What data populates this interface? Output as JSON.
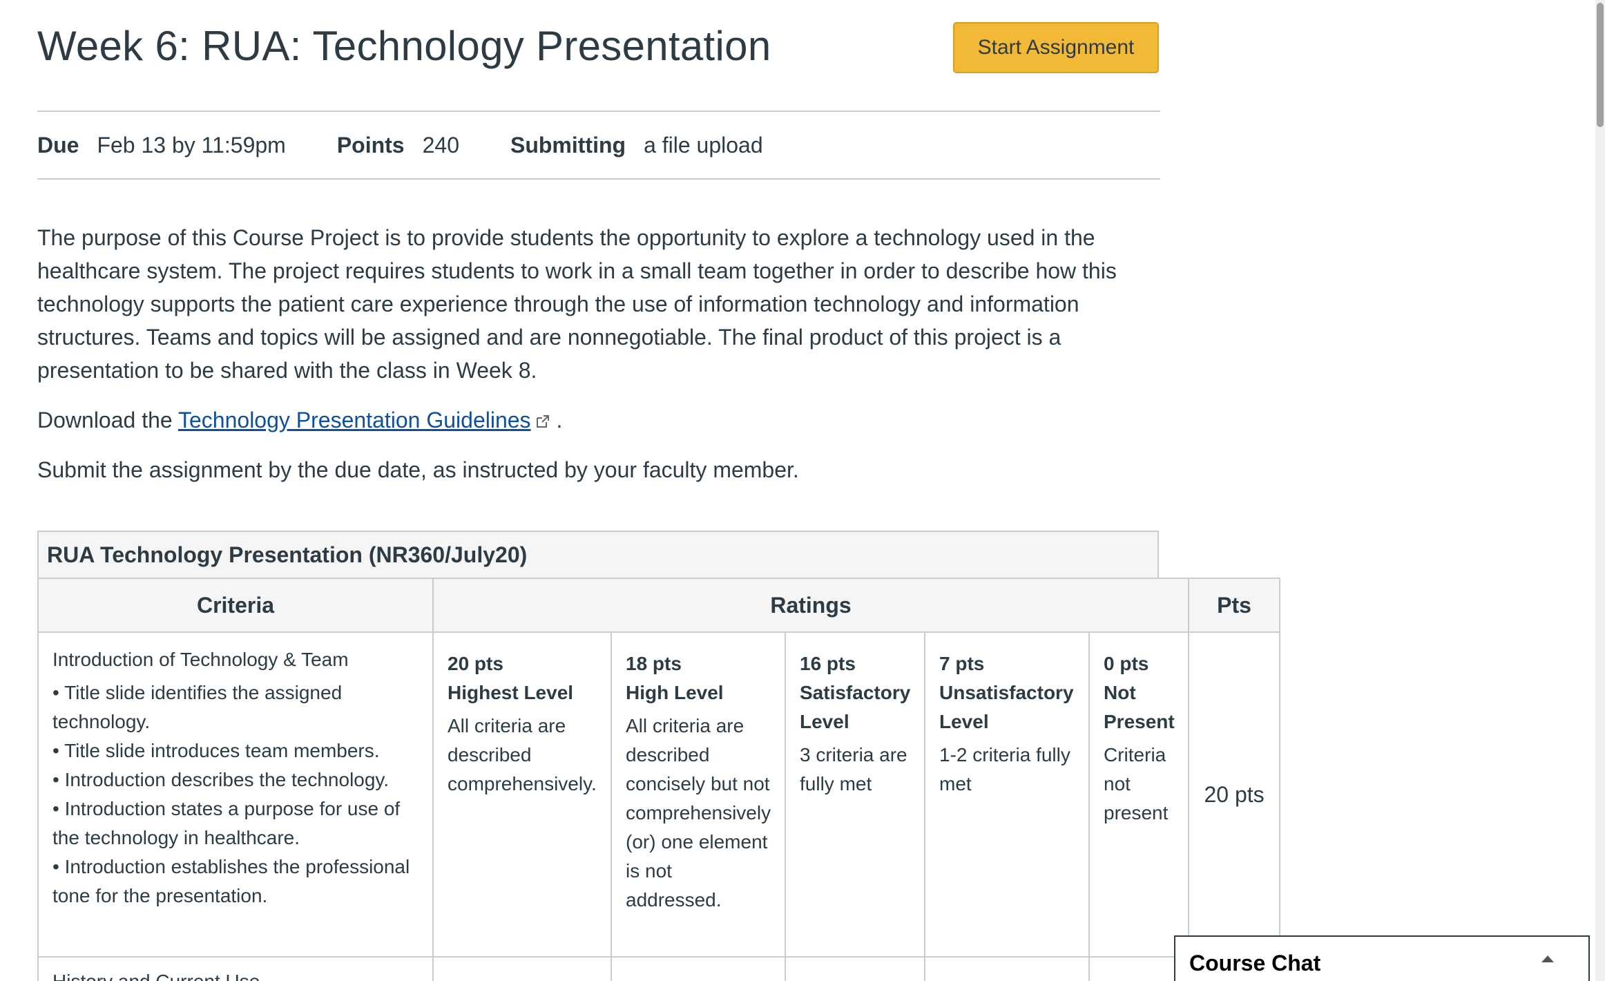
{
  "assignment": {
    "title": "Week 6: RUA: Technology Presentation",
    "start_button_label": "Start Assignment"
  },
  "meta": {
    "due_label": "Due",
    "due_value": "Feb 13 by 11:59pm",
    "points_label": "Points",
    "points_value": "240",
    "submitting_label": "Submitting",
    "submitting_value": "a file upload"
  },
  "description": {
    "paragraph": "The purpose of this Course Project is to provide students the opportunity to explore a technology used in the healthcare system. The project requires students to work in a small team together in order to describe how this technology supports the patient care experience through the use of information technology and information structures. Teams and topics will be assigned and are nonnegotiable. The final product of this project is a presentation to be shared with the class in Week 8.",
    "download_prefix": "Download the ",
    "download_link": "Technology Presentation Guidelines",
    "download_suffix": " .",
    "submit_text": "Submit the assignment by the due date, as instructed by your faculty member."
  },
  "rubric": {
    "title": "RUA Technology Presentation (NR360/July20)",
    "headers": {
      "criteria": "Criteria",
      "ratings": "Ratings",
      "pts": "Pts"
    },
    "rows": [
      {
        "criteria_title": "Introduction of Technology & Team",
        "bullets": [
          "• Title slide identifies the assigned technology.",
          "• Title slide introduces team members.",
          "• Introduction describes the technology.",
          "• Introduction states a purpose for use of the technology in healthcare.",
          "• Introduction establishes the professional tone for the presentation."
        ],
        "ratings": [
          {
            "pts": "20 pts",
            "level": "Highest Level",
            "desc": "All criteria are described comprehensively."
          },
          {
            "pts": "18 pts",
            "level": "High Level",
            "desc": "All criteria are described concisely but not comprehensively (or) one element is not addressed."
          },
          {
            "pts": "16 pts",
            "level": "Satisfactory Level",
            "desc": "3 criteria are fully met"
          },
          {
            "pts": "7 pts",
            "level": "Unsatisfactory Level",
            "desc": "1-2 criteria fully met"
          },
          {
            "pts": "0 pts",
            "level": "Not Present",
            "desc": "Criteria not present"
          }
        ],
        "total": "20 pts"
      }
    ],
    "next_row_criteria": "History and Current Use"
  },
  "course_chat": {
    "label": "Course Chat"
  },
  "icons": {
    "external_link": "external-link-icon",
    "chat_toggle": "caret-up-icon"
  },
  "colors": {
    "start_button_bg": "#f2b937",
    "link": "#0e4f9e",
    "text": "#2d3b45",
    "border": "#c7cdd1"
  }
}
